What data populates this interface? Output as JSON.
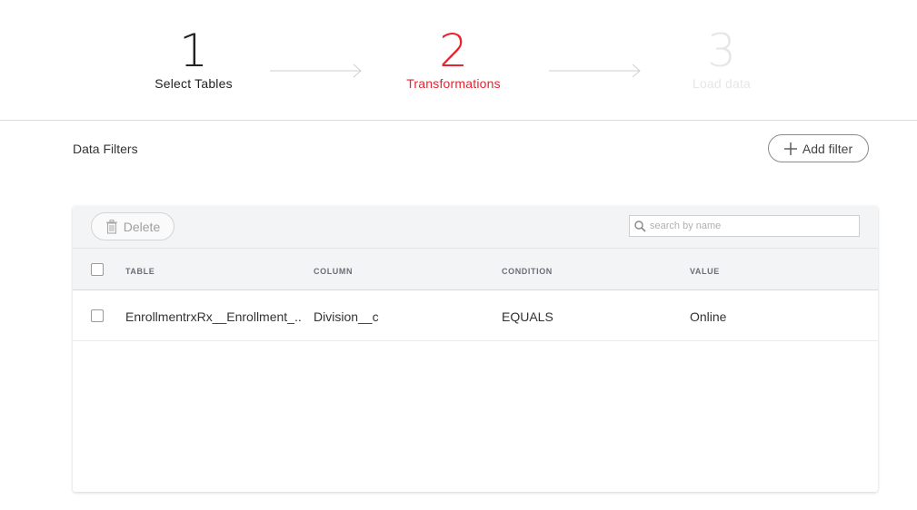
{
  "wizard": {
    "steps": [
      {
        "number": "1",
        "label": "Select Tables"
      },
      {
        "number": "2",
        "label": "Transformations"
      },
      {
        "number": "3",
        "label": "Load data"
      }
    ]
  },
  "filters": {
    "title": "Data Filters",
    "add_label": "Add filter"
  },
  "toolbar": {
    "delete_label": "Delete",
    "search_placeholder": "search by name"
  },
  "table": {
    "headers": [
      "TABLE",
      "COLUMN",
      "CONDITION",
      "VALUE"
    ],
    "rows": [
      {
        "table": "EnrollmentrxRx__Enrollment_..",
        "column": "Division__c",
        "condition": "EQUALS",
        "value": "Online"
      }
    ]
  },
  "colors": {
    "active_step": "#e8232f",
    "completed_step": "#222222",
    "pending_step": "#e6e6e6"
  }
}
